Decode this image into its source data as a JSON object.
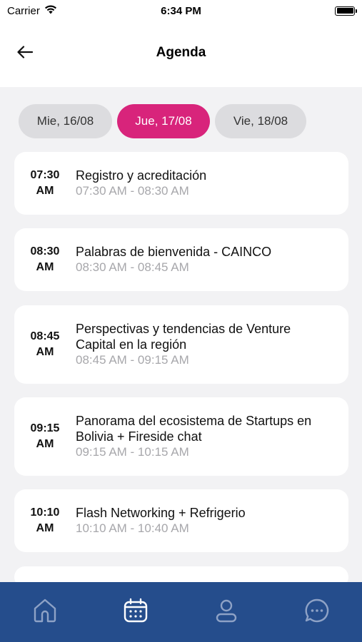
{
  "status_bar": {
    "carrier": "Carrier",
    "time": "6:34 PM"
  },
  "header": {
    "title": "Agenda",
    "back_icon": "arrow-left-icon"
  },
  "date_tabs": [
    {
      "label": "Mie, 16/08",
      "selected": false
    },
    {
      "label": "Jue, 17/08",
      "selected": true
    },
    {
      "label": "Vie, 18/08",
      "selected": false
    }
  ],
  "colors": {
    "accent": "#d8247b",
    "nav_bg": "#254d8c",
    "muted_text": "#a7a7ab",
    "background": "#f2f2f4"
  },
  "sessions": [
    {
      "start_hm": "07:30",
      "start_ampm": "AM",
      "title_lines": [
        "Registro y acreditación"
      ],
      "range": "07:30 AM - 08:30 AM"
    },
    {
      "start_hm": "08:30",
      "start_ampm": "AM",
      "title_lines": [
        "Palabras de bienvenida - CAINCO"
      ],
      "range": "08:30 AM - 08:45 AM"
    },
    {
      "start_hm": "08:45",
      "start_ampm": "AM",
      "title_lines": [
        "Perspectivas y tendencias de Venture",
        "Capital en la región"
      ],
      "range": "08:45 AM - 09:15 AM"
    },
    {
      "start_hm": "09:15",
      "start_ampm": "AM",
      "title_lines": [
        "Panorama del ecosistema de Startups en",
        "Bolivia + Fireside chat"
      ],
      "range": "09:15 AM - 10:15 AM"
    },
    {
      "start_hm": "10:10",
      "start_ampm": "AM",
      "title_lines": [
        "Flash Networking + Refrigerio"
      ],
      "range": "10:10 AM - 10:40 AM"
    }
  ],
  "bottom_nav": [
    {
      "icon": "home-icon",
      "active": false
    },
    {
      "icon": "calendar-icon",
      "active": true
    },
    {
      "icon": "user-icon",
      "active": false
    },
    {
      "icon": "chat-icon",
      "active": false
    }
  ]
}
